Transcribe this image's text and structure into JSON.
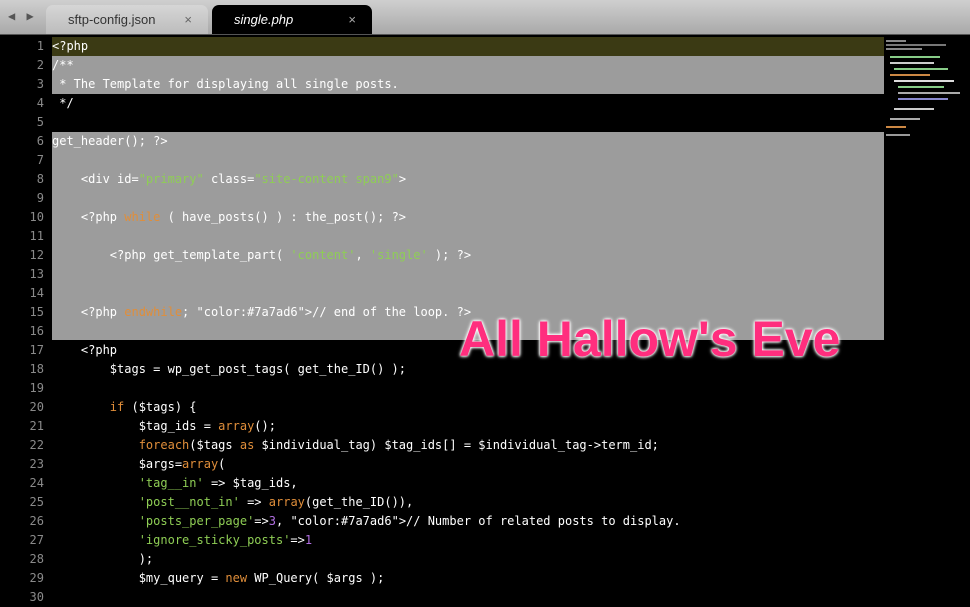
{
  "tabbar": {
    "nav_arrows": "◀ ▶",
    "tabs": [
      {
        "label": "sftp-config.json",
        "close": "×"
      },
      {
        "label": "single.php",
        "close": "×"
      }
    ]
  },
  "banner": {
    "text": "All Hallow's Eve"
  },
  "colors": {
    "pink": "#ff2e7e",
    "keyword": "#e08e3a",
    "string": "#8fce55",
    "comment": "#7a7ad6",
    "selection": "#9c9c9c",
    "current_line": "#3b3a14"
  },
  "lines": [
    {
      "n": "1",
      "text": "<?php"
    },
    {
      "n": "2",
      "text": "/**"
    },
    {
      "n": "3",
      "text": " * The Template for displaying all single posts."
    },
    {
      "n": "4",
      "text": " */"
    },
    {
      "n": "5",
      "text": ""
    },
    {
      "n": "6",
      "text": "get_header(); ?>"
    },
    {
      "n": "7",
      "text": ""
    },
    {
      "n": "8",
      "text": "    <div id=\"primary\" class=\"site-content span9\">"
    },
    {
      "n": "9",
      "text": ""
    },
    {
      "n": "10",
      "text": "    <?php while ( have_posts() ) : the_post(); ?>"
    },
    {
      "n": "11",
      "text": ""
    },
    {
      "n": "12",
      "text": "        <?php get_template_part( 'content', 'single' ); ?>"
    },
    {
      "n": "13",
      "text": ""
    },
    {
      "n": "14",
      "text": ""
    },
    {
      "n": "15",
      "text": "    <?php endwhile; // end of the loop. ?>"
    },
    {
      "n": "16",
      "text": ""
    },
    {
      "n": "17",
      "text": "    <?php"
    },
    {
      "n": "18",
      "text": "        $tags = wp_get_post_tags( get_the_ID() );"
    },
    {
      "n": "19",
      "text": ""
    },
    {
      "n": "20",
      "text": "        if ($tags) {"
    },
    {
      "n": "21",
      "text": "            $tag_ids = array();"
    },
    {
      "n": "22",
      "text": "            foreach($tags as $individual_tag) $tag_ids[] = $individual_tag->term_id;"
    },
    {
      "n": "23",
      "text": "            $args=array("
    },
    {
      "n": "24",
      "text": "            'tag__in' => $tag_ids,"
    },
    {
      "n": "25",
      "text": "            'post__not_in' => array(get_the_ID()),"
    },
    {
      "n": "26",
      "text": "            'posts_per_page'=>3, // Number of related posts to display."
    },
    {
      "n": "27",
      "text": "            'ignore_sticky_posts'=>1"
    },
    {
      "n": "28",
      "text": "            );"
    },
    {
      "n": "29",
      "text": "            $my_query = new WP_Query( $args );"
    },
    {
      "n": "30",
      "text": ""
    }
  ]
}
